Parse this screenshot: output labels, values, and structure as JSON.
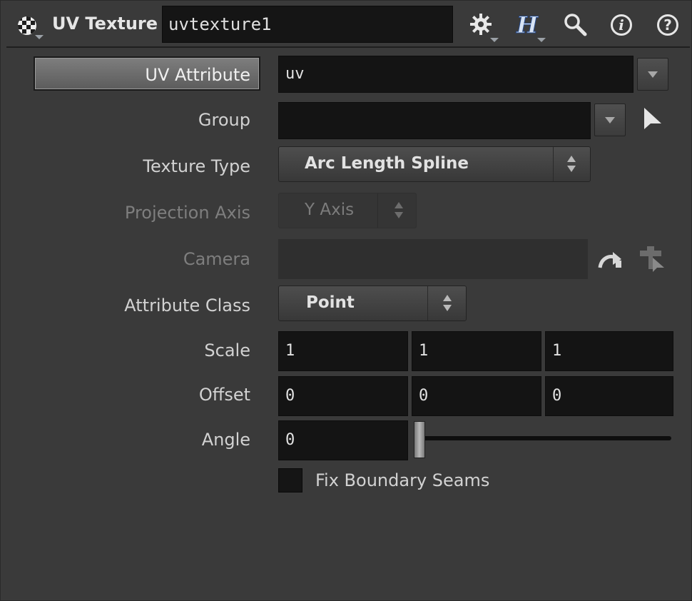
{
  "header": {
    "node_type": "UV Texture",
    "node_name": "uvtexture1",
    "icons": [
      "checker-icon",
      "gear-icon",
      "houdini-help-icon",
      "search-icon",
      "info-icon",
      "question-icon"
    ]
  },
  "params": {
    "uv_attribute": {
      "label": "UV Attribute",
      "value": "uv"
    },
    "group": {
      "label": "Group",
      "value": ""
    },
    "texture_type": {
      "label": "Texture Type",
      "value": "Arc Length Spline"
    },
    "projection_axis": {
      "label": "Projection Axis",
      "value": "Y Axis"
    },
    "camera": {
      "label": "Camera",
      "value": ""
    },
    "attribute_class": {
      "label": "Attribute Class",
      "value": "Point"
    },
    "scale": {
      "label": "Scale",
      "values": [
        "1",
        "1",
        "1"
      ]
    },
    "offset": {
      "label": "Offset",
      "values": [
        "0",
        "0",
        "0"
      ]
    },
    "angle": {
      "label": "Angle",
      "value": "0",
      "slider_fraction": 0.0
    },
    "fix_boundary_seams": {
      "label": "Fix Boundary Seams",
      "checked": false
    }
  },
  "colors": {
    "background": "#3a3a3a",
    "field": "#141414",
    "text": "#d2d2d2",
    "disabled_text": "#7e7e7e"
  }
}
